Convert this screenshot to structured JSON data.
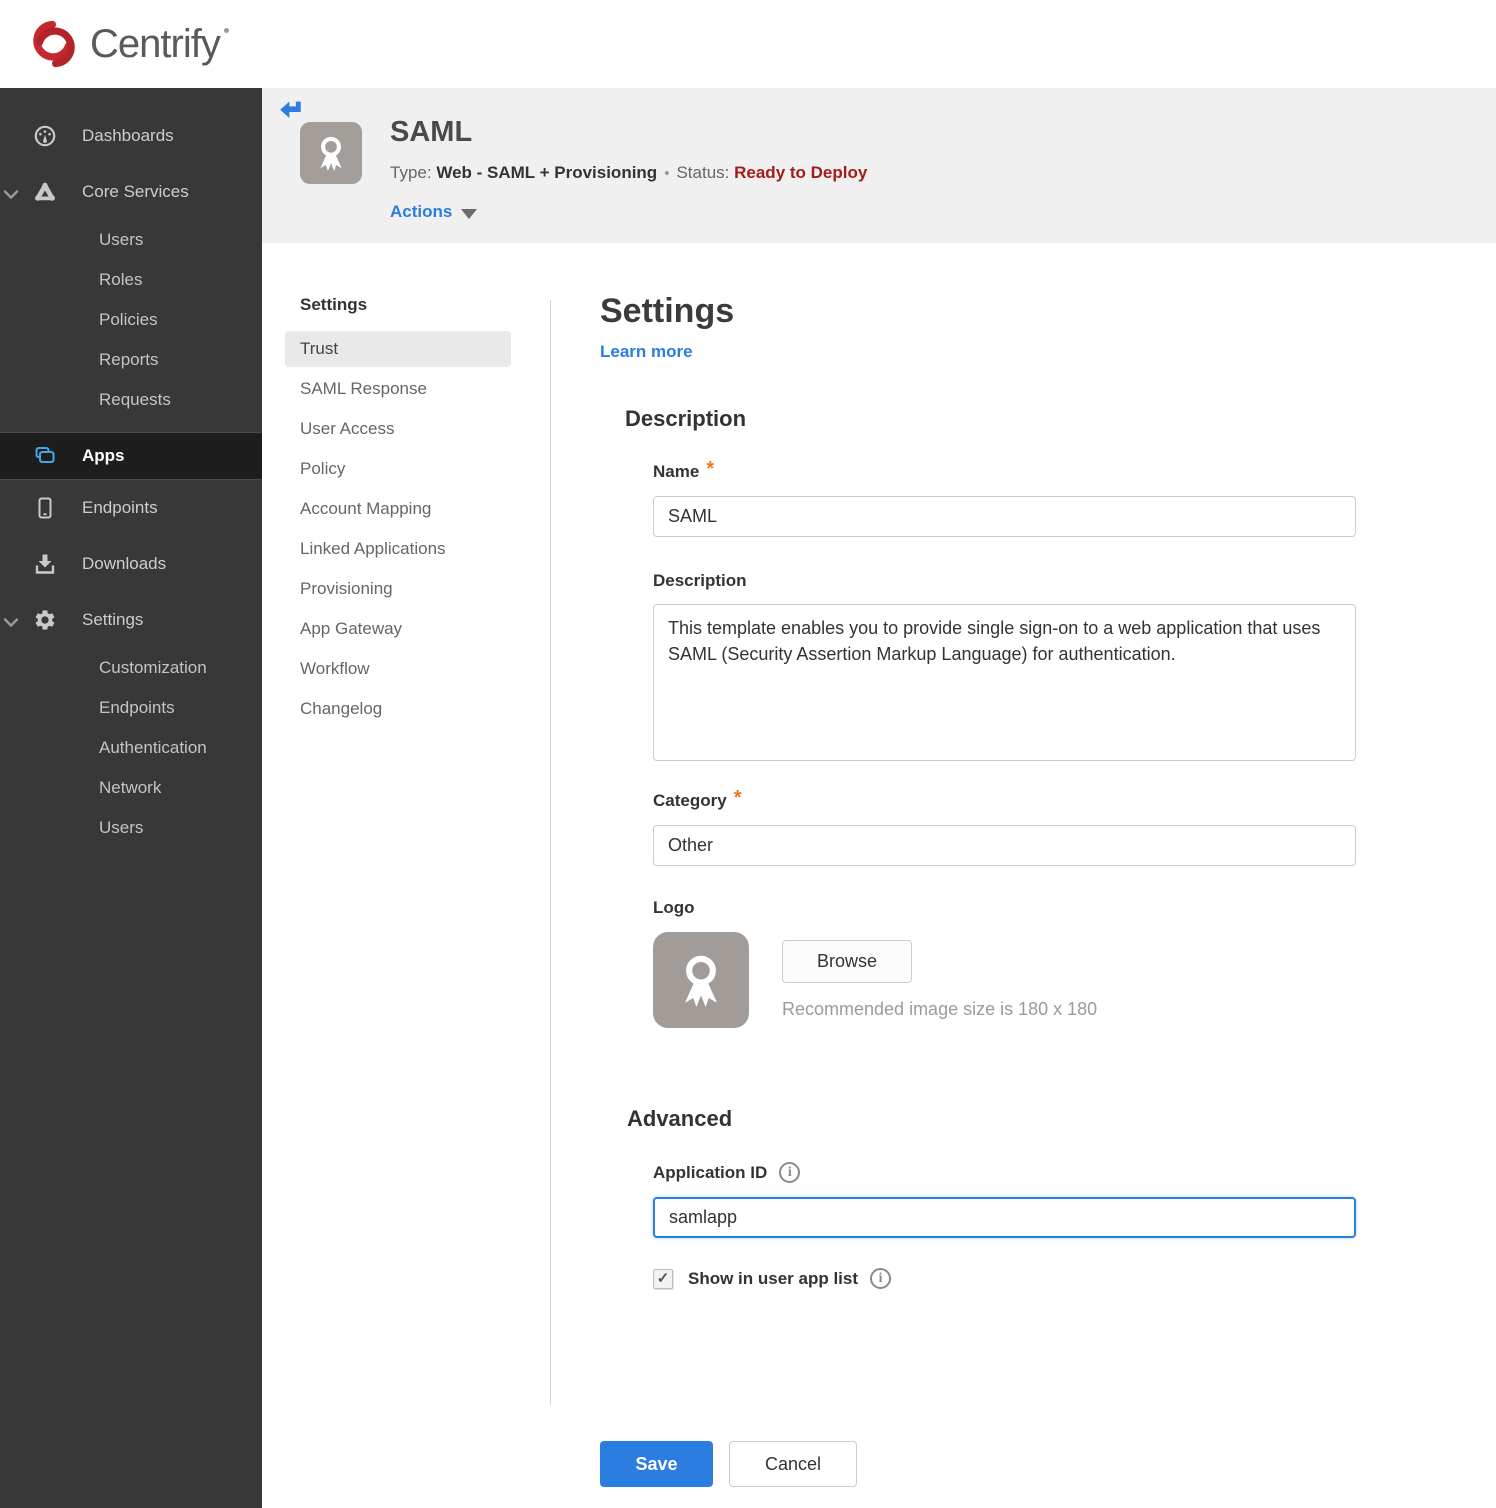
{
  "colors": {
    "accent_blue": "#2b7de0",
    "status_red": "#a21c1c",
    "brand_red": "#c5282f",
    "apps_icon_blue": "#41a8e0",
    "required_orange": "#ee7623",
    "sidebar_bg": "#383838",
    "sidebar_active_bg": "#1d1d1d",
    "header_band_bg": "#f0f0f0"
  },
  "ui": {
    "required_marker": "*"
  },
  "icons": {
    "brand": "centrify-swirl-icon",
    "back": "back-arrow-icon",
    "app_logo": "award-ribbon-icon",
    "info": "info-circle-icon",
    "dropdown": "caret-down-icon"
  },
  "topbar": {
    "brand": "Centrify"
  },
  "sidebar": {
    "items": [
      {
        "label": "Dashboards",
        "icon": "gauge-icon"
      },
      {
        "label": "Core Services",
        "icon": "core-services-icon",
        "expanded": true,
        "children": [
          "Users",
          "Roles",
          "Policies",
          "Reports",
          "Requests"
        ]
      },
      {
        "label": "Apps",
        "icon": "apps-icon",
        "active": true
      },
      {
        "label": "Endpoints",
        "icon": "device-icon"
      },
      {
        "label": "Downloads",
        "icon": "download-icon"
      },
      {
        "label": "Settings",
        "icon": "gear-icon",
        "expanded": true,
        "children": [
          "Customization",
          "Endpoints",
          "Authentication",
          "Network",
          "Users"
        ]
      }
    ]
  },
  "app_header": {
    "title": "SAML",
    "type_label": "Type:",
    "type_value": "Web - SAML + Provisioning",
    "separator": "•",
    "status_label": "Status:",
    "status_value": "Ready to Deploy",
    "actions_label": "Actions"
  },
  "subnav": {
    "header": "Settings",
    "selected": "Trust",
    "items": [
      "Trust",
      "SAML Response",
      "User Access",
      "Policy",
      "Account Mapping",
      "Linked Applications",
      "Provisioning",
      "App Gateway",
      "Workflow",
      "Changelog"
    ]
  },
  "main": {
    "title": "Settings",
    "learn_more": "Learn more",
    "description_section": {
      "heading": "Description",
      "name_label": "Name",
      "name_value": "SAML",
      "description_label": "Description",
      "description_value": "This template enables you to provide single sign-on to a web application that uses SAML (Security Assertion Markup Language) for authentication.",
      "category_label": "Category",
      "category_value": "Other",
      "logo_label": "Logo",
      "browse_label": "Browse",
      "recommended_text": "Recommended image size is 180 x 180"
    },
    "advanced_section": {
      "heading": "Advanced",
      "app_id_label": "Application ID",
      "app_id_value": "samlapp",
      "show_in_list_label": "Show in user app list",
      "checkbox_checked": true
    },
    "buttons": {
      "save": "Save",
      "cancel": "Cancel"
    }
  }
}
